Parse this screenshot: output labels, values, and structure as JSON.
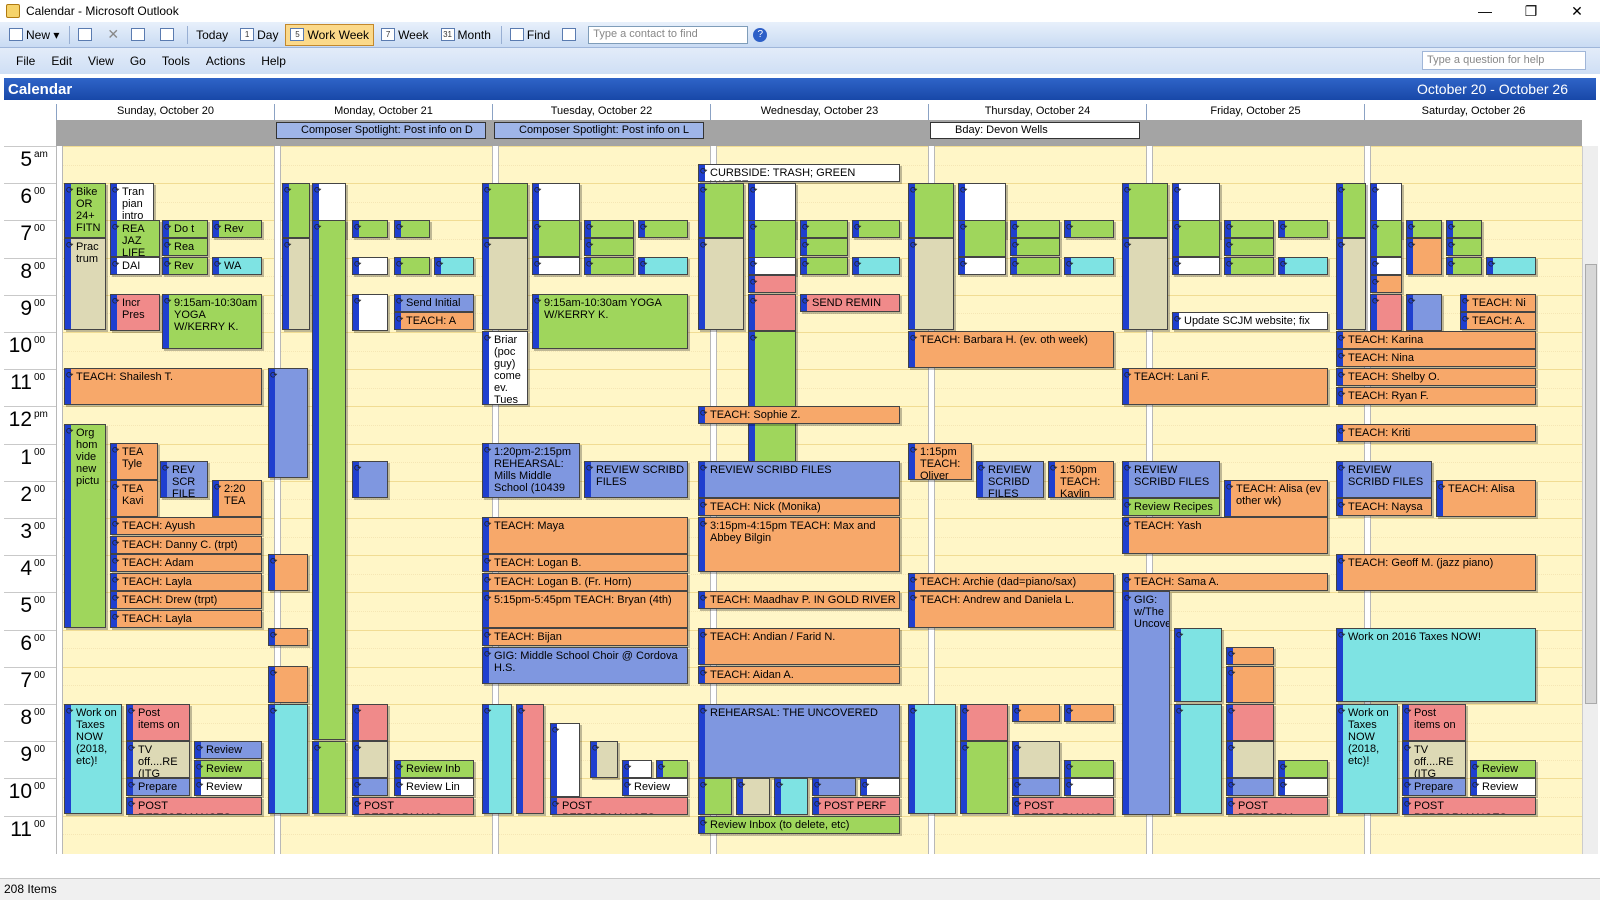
{
  "window": {
    "title": "Calendar - Microsoft Outlook"
  },
  "toolbar": {
    "new_label": "New",
    "today_label": "Today",
    "day_label": "Day",
    "work_week_label": "Work Week",
    "week_label": "Week",
    "month_label": "Month",
    "find_label": "Find",
    "contact_placeholder": "Type a contact to find",
    "day_num": "1",
    "work_week_num": "5",
    "week_num": "7",
    "month_num": "31"
  },
  "menu": {
    "file": "File",
    "edit": "Edit",
    "view": "View",
    "go": "Go",
    "tools": "Tools",
    "actions": "Actions",
    "help": "Help",
    "help_placeholder": "Type a question for help"
  },
  "calendar": {
    "title": "Calendar",
    "range": "October 20 - October 26"
  },
  "days": [
    "Sunday, October 20",
    "Monday, October 21",
    "Tuesday, October 22",
    "Wednesday, October 23",
    "Thursday, October 24",
    "Friday, October 25",
    "Saturday, October 26"
  ],
  "all_day": {
    "mon": "Composer Spotlight:  Post info on D",
    "tue": "Composer Spotlight:  Post info on L",
    "thu": "Bday:  Devon Wells"
  },
  "hours": [
    {
      "h": "5",
      "m": "am"
    },
    {
      "h": "6",
      "m": "00"
    },
    {
      "h": "7",
      "m": "00"
    },
    {
      "h": "8",
      "m": "00"
    },
    {
      "h": "9",
      "m": "00"
    },
    {
      "h": "10",
      "m": "00"
    },
    {
      "h": "11",
      "m": "00"
    },
    {
      "h": "12",
      "m": "pm"
    },
    {
      "h": "1",
      "m": "00"
    },
    {
      "h": "2",
      "m": "00"
    },
    {
      "h": "3",
      "m": "00"
    },
    {
      "h": "4",
      "m": "00"
    },
    {
      "h": "5",
      "m": "00"
    },
    {
      "h": "6",
      "m": "00"
    },
    {
      "h": "7",
      "m": "00"
    },
    {
      "h": "8",
      "m": "00"
    },
    {
      "h": "9",
      "m": "00"
    },
    {
      "h": "10",
      "m": "00"
    },
    {
      "h": "11",
      "m": "00"
    }
  ],
  "events": {
    "sun_bike": "Bike OR 24+ FITN",
    "sun_tran": "Tran pian intro",
    "sun_prac": "Prac trum",
    "sun_do": "Do t",
    "sun_rev1": "Rev",
    "sun_rea": "REA JAZ LIFE",
    "sun_rea2": "Rea",
    "sun_dai": "DAI",
    "sun_rev2": "Rev",
    "sun_wa": "WA",
    "sun_incr": "Incr Pres",
    "sun_yoga": "9:15am-10:30am YOGA W/KERRY K.",
    "sun_shailesh": "TEACH:  Shailesh T.",
    "sun_org": "Org hom vide new pictu",
    "sun_tea1": "TEA Tyle",
    "sun_rev3": "REV SCR FILE",
    "sun_220": "2:20 TEA",
    "sun_tea2": "TEA Kavi",
    "sun_ayush": "TEACH:  Ayush",
    "sun_danny": "TEACH:  Danny C. (trpt)",
    "sun_adam": "TEACH:  Adam",
    "sun_layla": "TEACH:  Layla",
    "sun_drew": "TEACH:  Drew (trpt)",
    "sun_layla2": "TEACH:  Layla",
    "sun_work": "Work on Taxes NOW (2018, etc)!",
    "sun_post": "Post items on",
    "sun_tv": "TV off....RE (ITG",
    "sun_review1": "Review",
    "sun_review2": "Review",
    "sun_prepare": "Prepare",
    "sun_review3": "Review",
    "sun_postperf": "POST PERFORMANCES",
    "mon_send": "Send Initial",
    "mon_teach_a": "TEACH:  A",
    "mon_reviewinb": "Review Inb",
    "mon_reviewlin": "Review Lin",
    "mon_postperf": "POST PERFORMANC",
    "tue_rehearsal": "1:20pm-2:15pm REHEARSAL: Mills Middle School (10439",
    "tue_yoga": "9:15am-10:30am YOGA W/KERRY K.",
    "tue_briar": "Briar (poc guy) come ev. Tues",
    "tue_review": "REVIEW SCRIBD FILES",
    "tue_maya": "TEACH:  Maya",
    "tue_logan": "TEACH:  Logan B.",
    "tue_logan2": "TEACH:  Logan B.  (Fr. Horn)",
    "tue_bryan": "5:15pm-5:45pm TEACH:  Bryan (4th)",
    "tue_bijan": "TEACH:  Bijan",
    "tue_gig": "GIG:  Middle School Choir @ Cordova H.S.",
    "tue_review2": "Review",
    "tue_postperf": "POST PERFORMANCES",
    "wed_curbside": "CURBSIDE:  TRASH; GREEN WASTE",
    "wed_send": "SEND REMIN",
    "wed_sophie": "TEACH:  Sophie Z.",
    "wed_review": "REVIEW SCRIBD FILES",
    "wed_nick": "TEACH:  Nick (Monika)",
    "wed_max": "3:15pm-4:15pm TEACH:  Max and Abbey Bilgin",
    "wed_maadhav": "TEACH:  Maadhav P. IN GOLD RIVER",
    "wed_andian": "TEACH:  Andian / Farid N.",
    "wed_aidan": "TEACH:  Aidan A.",
    "wed_uncovered": "REHEARSAL:  THE UNCOVERED",
    "wed_postperf": "POST PERF",
    "wed_reviewinbox": "Review Inbox (to delete, etc)",
    "thu_barbara": "TEACH:  Barbara H. (ev. oth week)",
    "thu_115": "1:15pm TEACH: Oliver",
    "thu_review": "REVIEW SCRIBD FILES",
    "thu_150": "1:50pm TEACH: Kaylin",
    "thu_archie": "TEACH:  Archie (dad=piano/sax)",
    "thu_andrew": "TEACH:  Andrew and Daniela L.",
    "thu_postperf": "POST PERFORMANC",
    "fri_update": "Update SCJM website; fix",
    "fri_lani": "TEACH:  Lani F.",
    "fri_review": "REVIEW SCRIBD FILES",
    "fri_alisa": "TEACH:  Alisa (ev other wk)",
    "fri_recipes": "Review Recipes",
    "fri_yash": "TEACH:  Yash",
    "fri_sama": "TEACH:  Sama A.",
    "fri_gig": "GIG: w/The Uncover",
    "fri_postperf": "POST PERFORM",
    "sat_karina": "TEACH:  Karina",
    "sat_nina": "TEACH:  Nina",
    "sat_shelby": "TEACH:  Shelby O.",
    "sat_ryan": "TEACH:  Ryan F.",
    "sat_kriti": "TEACH:  Kriti",
    "sat_review": "REVIEW SCRIBD FILES",
    "sat_alisa": "TEACH:  Alisa",
    "sat_naysa": "TEACH:  Naysa",
    "sat_geoff": "TEACH:  Geoff M. (jazz piano)",
    "sat_taxes": "Work on 2016 Taxes NOW!",
    "sat_work": "Work on Taxes NOW (2018, etc)!",
    "sat_post": "Post items on",
    "sat_tv": "TV off....RE (ITG",
    "sat_review1": "Review",
    "sat_prepare": "Prepare",
    "sat_review2": "Review",
    "sat_postperf": "POST PERFORMANCES",
    "sat_teach_ni": "TEACH:  Ni",
    "sat_teach_a": "TEACH:  A."
  },
  "status": {
    "items": "208 Items"
  }
}
